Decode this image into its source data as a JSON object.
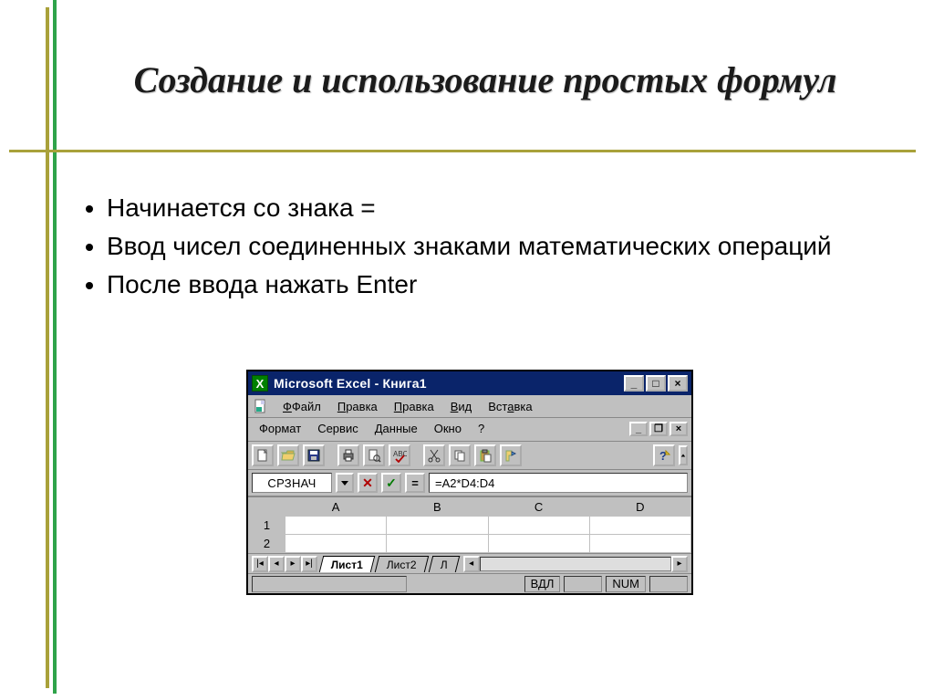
{
  "title": "Создание и использование простых формул",
  "bullets": [
    "Начинается со знака =",
    "Ввод чисел соединенных знаками математических операций",
    "После ввода нажать Enter"
  ],
  "excel": {
    "window_title": "Microsoft Excel - Книга1",
    "menu": {
      "file": "Файл",
      "edit1": "Правка",
      "edit2": "Правка",
      "view": "Вид",
      "insert": "Вставка",
      "format": "Формат",
      "tools": "Сервис",
      "data": "Данные",
      "window": "Окно",
      "help": "?"
    },
    "namebox": "СРЗНАЧ",
    "formula": "=A2*D4:D4",
    "columns": [
      "A",
      "B",
      "C",
      "D"
    ],
    "rows": [
      "1",
      "2"
    ],
    "tabs": {
      "active": "Лист1",
      "inactive": "Лист2",
      "partial": "Л"
    },
    "status": {
      "bdl": "ВДЛ",
      "num": "NUM"
    }
  }
}
